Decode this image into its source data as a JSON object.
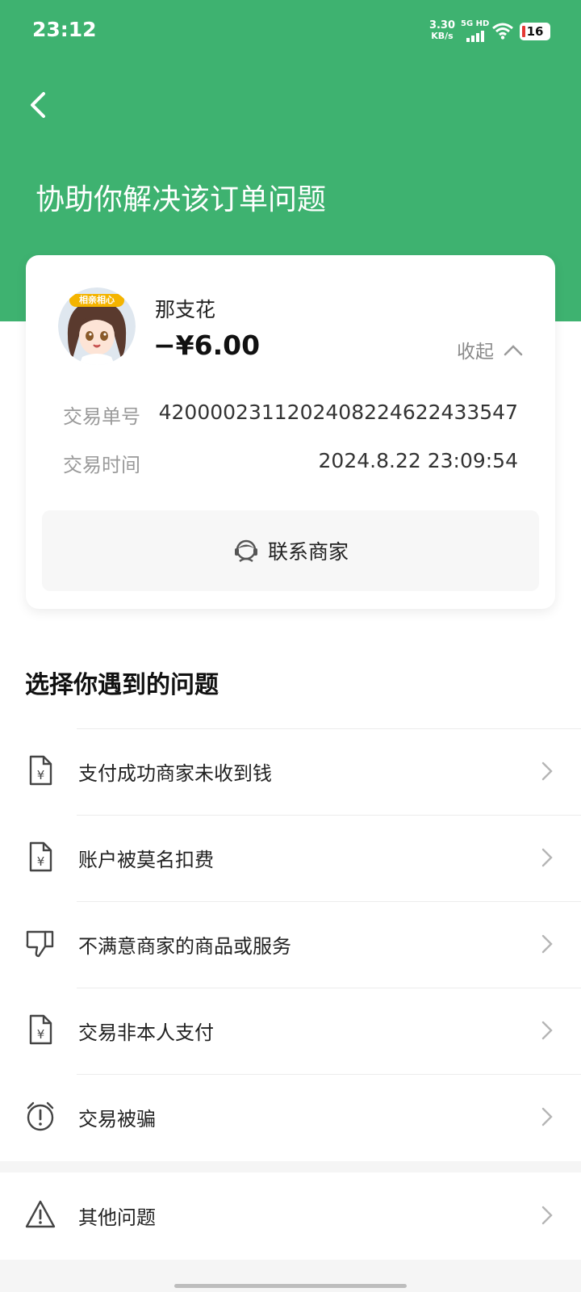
{
  "status_bar": {
    "time": "23:12",
    "net_speed_value": "3.30",
    "net_speed_unit": "KB/s",
    "network": "5G HD",
    "battery": "16",
    "icons": [
      "signal-icon",
      "wifi-icon",
      "battery-icon"
    ]
  },
  "header": {
    "title": "协助你解决该订单问题",
    "back_icon": "back-arrow-icon",
    "color": "#3eb270"
  },
  "order": {
    "merchant_name": "那支花",
    "amount": "−¥6.00",
    "collapse_label": "收起",
    "transaction_no_label": "交易单号",
    "transaction_no": "4200002311202408224622433547",
    "transaction_time_label": "交易时间",
    "transaction_time": "2024.8.22 23:09:54",
    "contact_label": "联系商家",
    "avatar_badge": "相亲相心"
  },
  "issues": {
    "title": "选择你遇到的问题",
    "items": [
      {
        "label": "支付成功商家未收到钱",
        "icon": "yuan-document-icon"
      },
      {
        "label": "账户被莫名扣费",
        "icon": "yuan-document-icon"
      },
      {
        "label": "不满意商家的商品或服务",
        "icon": "thumbs-down-icon"
      },
      {
        "label": "交易非本人支付",
        "icon": "yuan-document-icon"
      },
      {
        "label": "交易被骗",
        "icon": "alarm-warning-icon"
      }
    ],
    "other": {
      "label": "其他问题",
      "icon": "warning-triangle-icon"
    }
  }
}
